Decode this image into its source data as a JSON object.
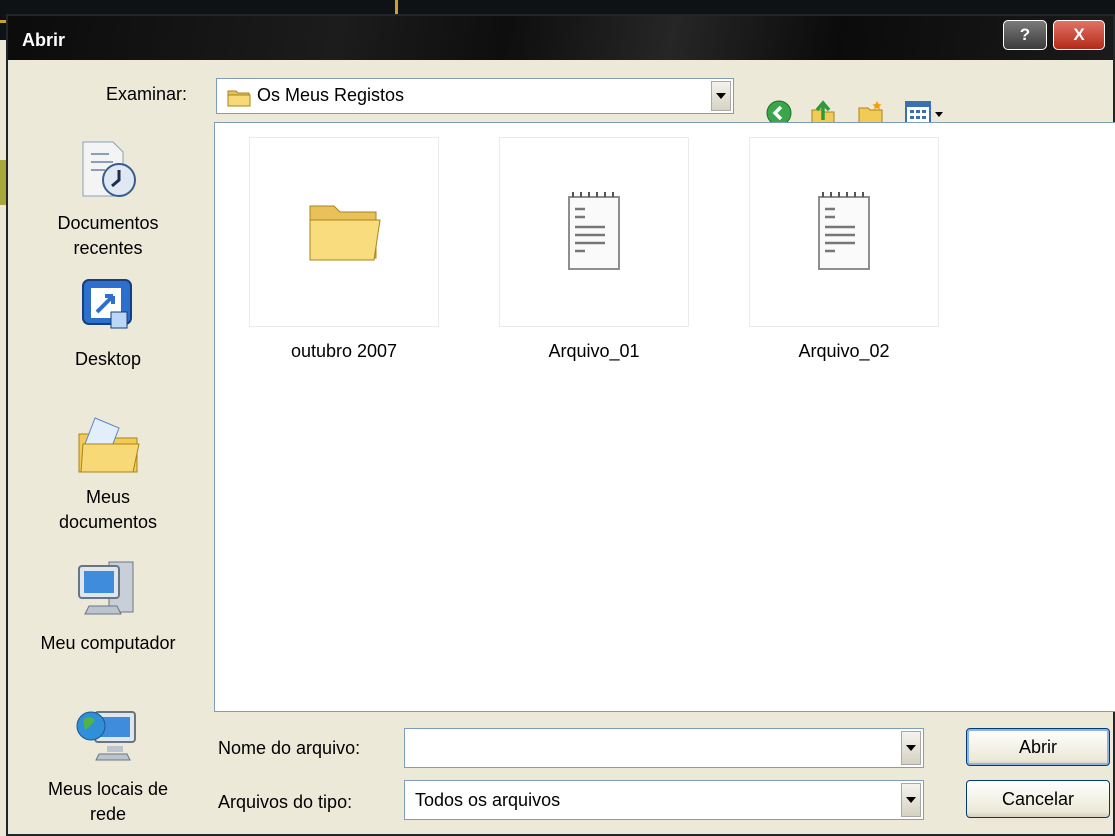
{
  "dialog": {
    "title": "Abrir",
    "help_label": "?",
    "close_label": "X"
  },
  "look_in": {
    "label": "Examinar:",
    "value": "Os Meus Registos"
  },
  "toolbar": {
    "icons": [
      "back-icon",
      "up-folder-icon",
      "new-folder-icon",
      "view-menu-icon"
    ]
  },
  "places": [
    {
      "label_lines": [
        "Documentos",
        "recentes"
      ],
      "icon": "recent-documents-icon"
    },
    {
      "label_lines": [
        "Desktop"
      ],
      "icon": "desktop-icon"
    },
    {
      "label_lines": [
        "Meus",
        "documentos"
      ],
      "icon": "my-documents-icon"
    },
    {
      "label_lines": [
        "Meu computador"
      ],
      "icon": "my-computer-icon"
    },
    {
      "label_lines": [
        "Meus locais de",
        "rede"
      ],
      "icon": "network-places-icon"
    }
  ],
  "files": [
    {
      "name": "outubro 2007",
      "type": "folder"
    },
    {
      "name": "Arquivo_01",
      "type": "text"
    },
    {
      "name": "Arquivo_02",
      "type": "text"
    }
  ],
  "filename": {
    "label": "Nome do arquivo:",
    "value": ""
  },
  "filetype": {
    "label": "Arquivos do tipo:",
    "value": "Todos os arquivos"
  },
  "buttons": {
    "open": "Abrir",
    "cancel": "Cancelar"
  },
  "colors": {
    "dialog_face": "#ece9d8",
    "field_border": "#7f9db9",
    "close_red": "#c7402f"
  }
}
